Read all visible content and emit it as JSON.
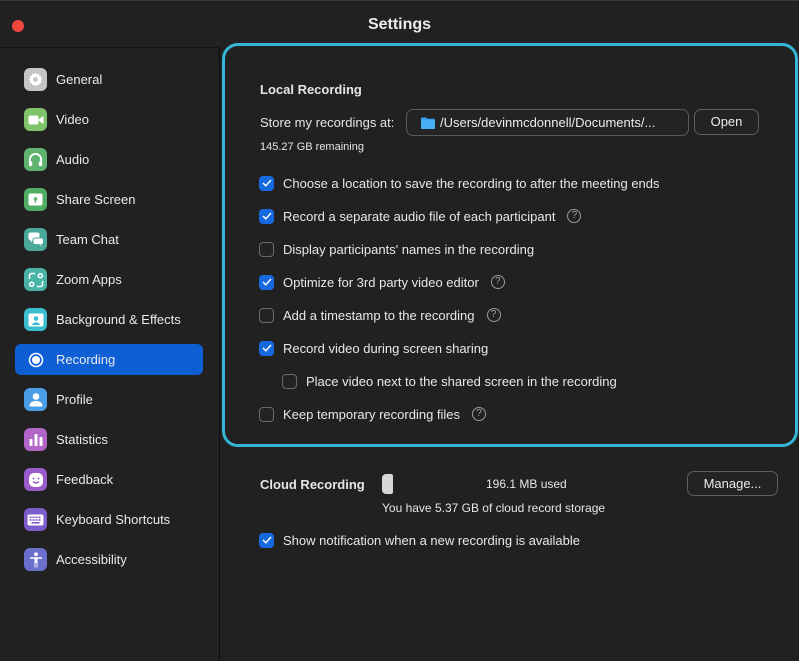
{
  "window": {
    "title": "Settings"
  },
  "sidebar": {
    "items": [
      {
        "label": "General",
        "icon": "gear-icon",
        "color": "#c5c5c5",
        "active": false
      },
      {
        "label": "Video",
        "icon": "video-camera-icon",
        "color": "#7fc36a",
        "active": false
      },
      {
        "label": "Audio",
        "icon": "headphones-icon",
        "color": "#5fb56f",
        "active": false
      },
      {
        "label": "Share Screen",
        "icon": "share-screen-icon",
        "color": "#4fae63",
        "active": false
      },
      {
        "label": "Team Chat",
        "icon": "chat-icon",
        "color": "#4aa99a",
        "active": false
      },
      {
        "label": "Zoom Apps",
        "icon": "apps-icon",
        "color": "#49b4a6",
        "active": false
      },
      {
        "label": "Background & Effects",
        "icon": "background-icon",
        "color": "#3bbdd0",
        "active": false
      },
      {
        "label": "Recording",
        "icon": "record-icon",
        "color": "#0e5fd4",
        "active": true
      },
      {
        "label": "Profile",
        "icon": "profile-icon",
        "color": "#4a9ee8",
        "active": false
      },
      {
        "label": "Statistics",
        "icon": "statistics-icon",
        "color": "#b266c8",
        "active": false
      },
      {
        "label": "Feedback",
        "icon": "feedback-icon",
        "color": "#9a5ccb",
        "active": false
      },
      {
        "label": "Keyboard Shortcuts",
        "icon": "keyboard-icon",
        "color": "#7d5ccb",
        "active": false
      },
      {
        "label": "Accessibility",
        "icon": "accessibility-icon",
        "color": "#6b6fcc",
        "active": false
      }
    ]
  },
  "local_recording": {
    "title": "Local Recording",
    "store_label": "Store my recordings at:",
    "path": "/Users/devinmcdonnell/Documents/...",
    "open_label": "Open",
    "remaining": "145.27 GB remaining",
    "options": [
      {
        "label": "Choose a location to save the recording to after the meeting ends",
        "checked": true,
        "help": false,
        "indent": false
      },
      {
        "label": "Record a separate audio file of each participant",
        "checked": true,
        "help": true,
        "indent": false
      },
      {
        "label": "Display participants' names in the recording",
        "checked": false,
        "help": false,
        "indent": false
      },
      {
        "label": "Optimize for 3rd party video editor",
        "checked": true,
        "help": true,
        "indent": false
      },
      {
        "label": "Add a timestamp to the recording",
        "checked": false,
        "help": true,
        "indent": false
      },
      {
        "label": "Record video during screen sharing",
        "checked": true,
        "help": false,
        "indent": false
      },
      {
        "label": "Place video next to the shared screen in the recording",
        "checked": false,
        "help": false,
        "indent": true
      },
      {
        "label": "Keep temporary recording files",
        "checked": false,
        "help": true,
        "indent": false
      }
    ]
  },
  "cloud_recording": {
    "title": "Cloud Recording",
    "used": "196.1 MB used",
    "used_fraction": 0.036,
    "storage_text": "You have 5.37 GB of cloud record storage",
    "manage_label": "Manage...",
    "notify": {
      "label": "Show notification when a new recording is available",
      "checked": true
    }
  },
  "help_glyph": "?",
  "colors": {
    "accent": "#0e5fd4",
    "checkbox": "#1769e0",
    "focus_ring": "#35b6d6",
    "close": "#f0453f"
  }
}
